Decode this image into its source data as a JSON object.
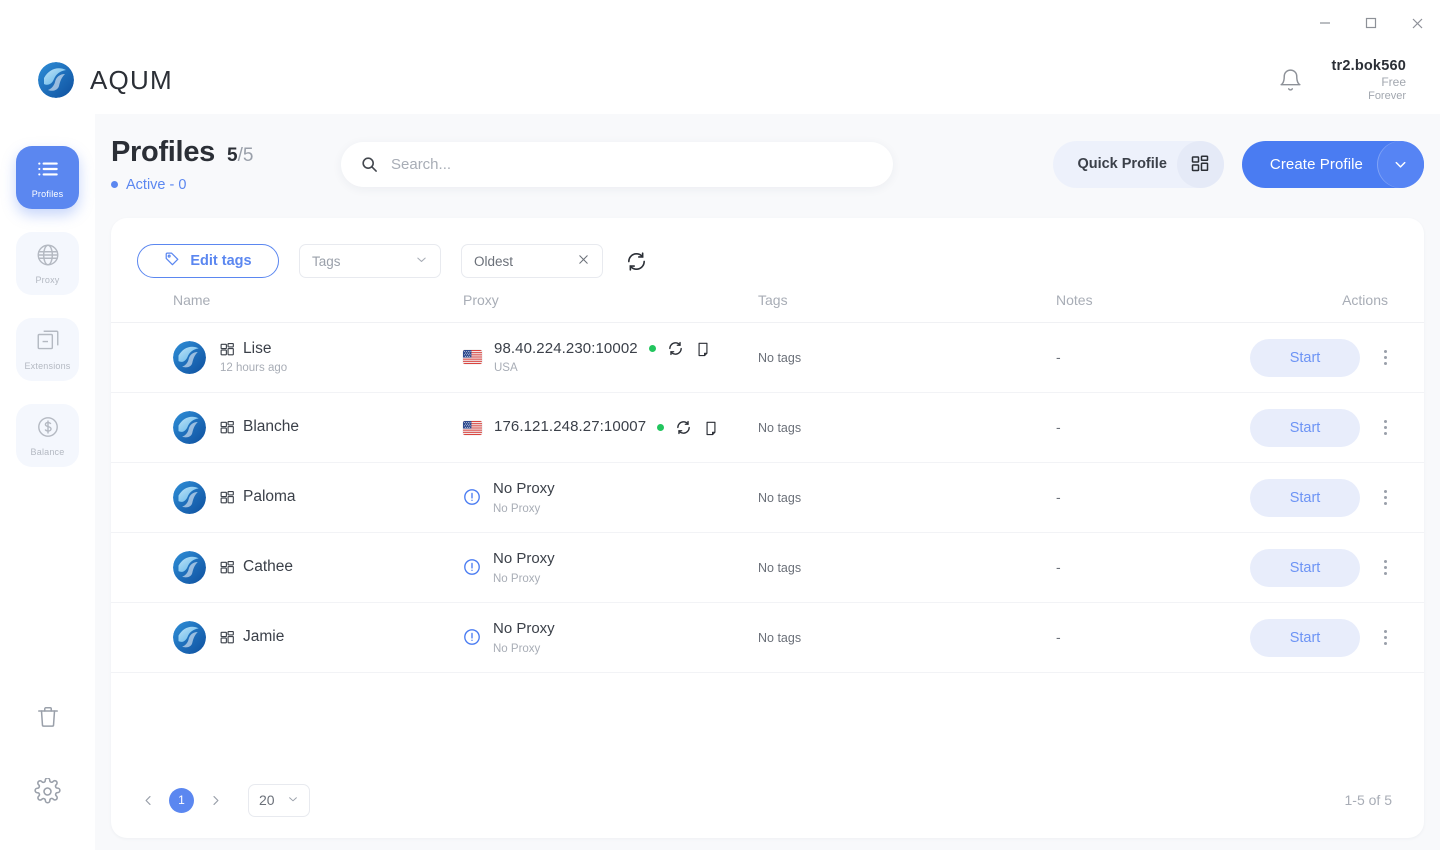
{
  "window": {
    "minimize_label": "minimize",
    "maximize_label": "maximize",
    "close_label": "close"
  },
  "brand": {
    "name": "AQUM"
  },
  "user": {
    "name": "tr2.bok560",
    "plan": "Free",
    "plan_period": "Forever"
  },
  "sidebar": {
    "items": [
      {
        "label": "Profiles",
        "icon": "list-icon",
        "active": true
      },
      {
        "label": "Proxy",
        "icon": "globe-icon",
        "active": false
      },
      {
        "label": "Extensions",
        "icon": "extensions-icon",
        "active": false
      },
      {
        "label": "Balance",
        "icon": "dollar-coin-icon",
        "active": false
      }
    ],
    "bottom": [
      {
        "name": "trash-icon"
      },
      {
        "name": "settings-gear-icon"
      }
    ]
  },
  "header": {
    "title": "Profiles",
    "count_current": "5",
    "count_sep": "/",
    "count_total": "5",
    "active_text": "Active - 0",
    "active_color": "#5b87f0"
  },
  "search": {
    "placeholder": "Search...",
    "value": ""
  },
  "actions": {
    "quick_profile_label": "Quick Profile",
    "create_profile_label": "Create Profile"
  },
  "filters": {
    "edit_tags_label": "Edit tags",
    "tags_placeholder": "Tags",
    "sort_value": "Oldest"
  },
  "table": {
    "columns": [
      "Name",
      "Proxy",
      "Tags",
      "Notes",
      "Actions"
    ],
    "rows": [
      {
        "name": "Lise",
        "sub": "12 hours ago",
        "proxy": "98.40.224.230:10002",
        "proxy_sub": "USA",
        "has_proxy": true,
        "status_color": "#22c55e",
        "tags": "No tags",
        "notes": "-",
        "action": "Start"
      },
      {
        "name": "Blanche",
        "sub": "",
        "proxy": "176.121.248.27:10007",
        "proxy_sub": "",
        "has_proxy": true,
        "status_color": "#22c55e",
        "tags": "No tags",
        "notes": "-",
        "action": "Start"
      },
      {
        "name": "Paloma",
        "sub": "",
        "proxy": "No Proxy",
        "proxy_sub": "No Proxy",
        "has_proxy": false,
        "status_color": "",
        "tags": "No tags",
        "notes": "-",
        "action": "Start"
      },
      {
        "name": "Cathee",
        "sub": "",
        "proxy": "No Proxy",
        "proxy_sub": "No Proxy",
        "has_proxy": false,
        "status_color": "",
        "tags": "No tags",
        "notes": "-",
        "action": "Start"
      },
      {
        "name": "Jamie",
        "sub": "",
        "proxy": "No Proxy",
        "proxy_sub": "No Proxy",
        "has_proxy": false,
        "status_color": "",
        "tags": "No tags",
        "notes": "-",
        "action": "Start"
      }
    ]
  },
  "footer": {
    "page": "1",
    "per_page": "20",
    "range": "1-5 of 5"
  },
  "colors": {
    "accent": "#4a7cf2",
    "accent_soft": "#5b87f0",
    "page_bg": "#f8f9fb",
    "muted": "#a8adb6"
  }
}
